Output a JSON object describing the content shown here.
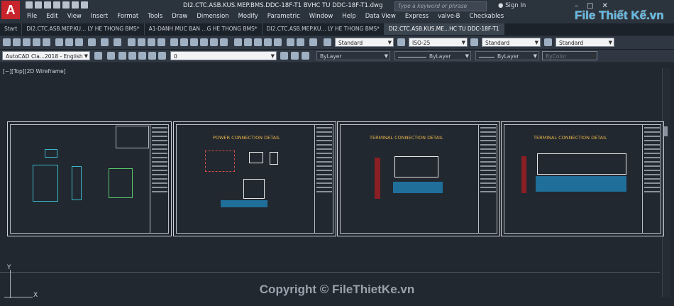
{
  "titlebar": {
    "app_logo": "A",
    "doc_title": "DI2.CTC.ASB.KUS.MEP.BMS.DDC-18F-T1 BVHC TU DDC-18F-T1.dwg",
    "search_placeholder": "Type a keyword or phrase",
    "sign_in": "Sign In",
    "watermark": "File Thiết Kế.vn"
  },
  "menu": [
    "File",
    "Edit",
    "View",
    "Insert",
    "Format",
    "Tools",
    "Draw",
    "Dimension",
    "Modify",
    "Parametric",
    "Window",
    "Help",
    "Data View",
    "Express",
    "valve-B",
    "Checkables"
  ],
  "tabs": [
    {
      "label": "Start"
    },
    {
      "label": "DI2.CTC.ASB.MEP.KU... LY HE THONG BMS*"
    },
    {
      "label": "A1-DANH MUC BAN ...G HE THONG BMS*"
    },
    {
      "label": "DI2.CTC.ASB.MEP.KU... LY HE THONG BMS*"
    },
    {
      "label": "DI2.CTC.ASB.KUS.ME...HC TU DDC-18F-T1"
    }
  ],
  "toolbar": {
    "text_style": "Standard",
    "dim_style": "ISO-25",
    "table_style": "Standard",
    "mleader_style": "Standard",
    "workspace": "AutoCAD Cla...2018 - English",
    "layer": "0",
    "color": "ByLayer",
    "linetype": "ByLayer",
    "lineweight": "ByLayer",
    "plotstyle": "ByColor"
  },
  "viewport": {
    "label": "[−][Top][2D Wireframe]"
  },
  "sheets": [
    {
      "title": ""
    },
    {
      "title": "POWER CONNECTION DETAIL"
    },
    {
      "title": "TERMINAL CONNECTION DETAIL"
    },
    {
      "title": "TERMINAL CONNECTION DETAIL"
    }
  ],
  "ucs": {
    "y": "Y",
    "x": "X"
  },
  "footer": {
    "copyright": "Copyright © FileThietKe.vn"
  }
}
